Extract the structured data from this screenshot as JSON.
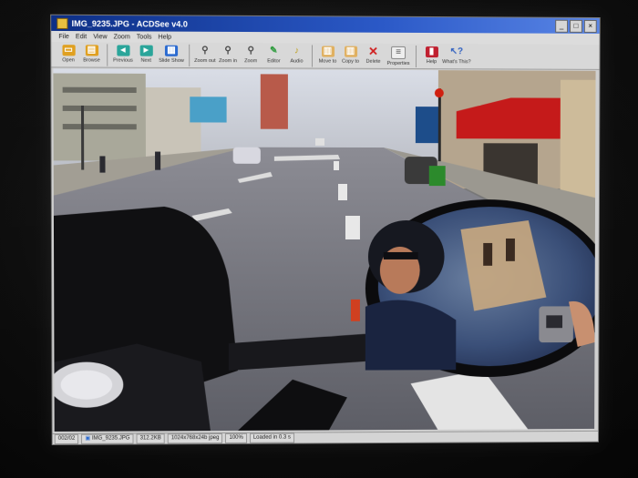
{
  "window": {
    "title": "IMG_9235.JPG - ACDSee v4.0"
  },
  "menu": [
    "File",
    "Edit",
    "View",
    "Zoom",
    "Tools",
    "Help"
  ],
  "toolbar": [
    {
      "label": "Open",
      "icon": "folder-open-icon",
      "color": "#e0a020"
    },
    {
      "label": "Browse",
      "icon": "folder-browse-icon",
      "color": "#e0a020"
    },
    {
      "label": "Previous",
      "icon": "previous-icon",
      "color": "#2aa59a"
    },
    {
      "label": "Next",
      "icon": "next-icon",
      "color": "#2aa59a"
    },
    {
      "label": "Slide Show",
      "icon": "slideshow-icon",
      "color": "#2a6ad0"
    },
    {
      "label": "Zoom out",
      "icon": "zoom-out-icon",
      "color": "#5a5a5a"
    },
    {
      "label": "Zoom in",
      "icon": "zoom-in-icon",
      "color": "#5a5a5a"
    },
    {
      "label": "Zoom",
      "icon": "zoom-icon",
      "color": "#5a5a5a"
    },
    {
      "label": "Editor",
      "icon": "editor-icon",
      "color": "#2a9a3a"
    },
    {
      "label": "Audio",
      "icon": "audio-icon",
      "color": "#c0a020"
    },
    {
      "label": "Move to",
      "icon": "move-to-icon",
      "color": "#c07a20"
    },
    {
      "label": "Copy to",
      "icon": "copy-to-icon",
      "color": "#c07a20"
    },
    {
      "label": "Delete",
      "icon": "delete-icon",
      "color": "#d02020"
    },
    {
      "label": "Properties",
      "icon": "properties-icon",
      "color": "#808080"
    },
    {
      "label": "Help",
      "icon": "help-book-icon",
      "color": "#c02030"
    },
    {
      "label": "What's This?",
      "icon": "whats-this-icon",
      "color": "#3060c0"
    }
  ],
  "status": {
    "index": "002/02",
    "filename": "IMG_9235.JPG",
    "filesize": "312.2KB",
    "dimensions": "1024x768x24b jpeg",
    "zoom": "100%",
    "load": "Loaded in 0.3 s"
  }
}
